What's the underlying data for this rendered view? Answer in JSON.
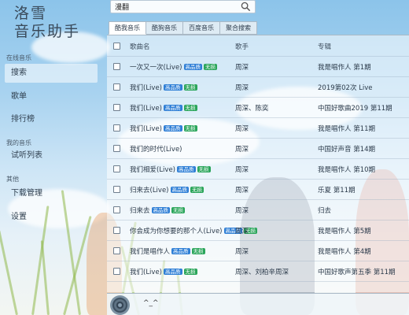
{
  "app": {
    "title_line1": "洛雪",
    "title_line2": "音乐助手"
  },
  "sidebar": {
    "sections": [
      {
        "label": "在线音乐",
        "items": [
          {
            "label": "搜索",
            "active": true
          },
          {
            "label": "歌单"
          },
          {
            "label": "排行榜"
          }
        ]
      },
      {
        "label": "我的音乐",
        "items": [
          {
            "label": "试听列表"
          }
        ]
      },
      {
        "label": "其他",
        "items": [
          {
            "label": "下载管理"
          },
          {
            "label": "设置"
          }
        ]
      }
    ]
  },
  "search": {
    "value": "漫翻",
    "icon": "search-icon"
  },
  "tabs": [
    {
      "label": "酷我音乐",
      "active": true
    },
    {
      "label": "酷狗音乐"
    },
    {
      "label": "百度音乐"
    },
    {
      "label": "聚合搜索"
    }
  ],
  "table": {
    "headers": {
      "name": "歌曲名",
      "artist": "歌手",
      "album": "专辑"
    },
    "rows": [
      {
        "name": "一次又一次(Live)",
        "badges": [
          "高品质",
          "无损"
        ],
        "artist": "周深",
        "album": "我是唱作人 第1期"
      },
      {
        "name": "我们(Live)",
        "badges": [
          "高品质",
          "无损"
        ],
        "artist": "周深",
        "album": "2019第02次 Live"
      },
      {
        "name": "我们(Live)",
        "badges": [
          "高品质",
          "无损"
        ],
        "artist": "周深、陈奕",
        "album": "中国好歌曲2019 第11期"
      },
      {
        "name": "我们(Live)",
        "badges": [
          "高品质",
          "无损"
        ],
        "artist": "周深",
        "album": "我是唱作人 第11期"
      },
      {
        "name": "我们的时代(Live)",
        "badges": [],
        "artist": "周深",
        "album": "中国好声音 第14期"
      },
      {
        "name": "我们相爱(Live)",
        "badges": [
          "高品质",
          "无损"
        ],
        "artist": "周深",
        "album": "我是唱作人 第10期"
      },
      {
        "name": "归来去(Live)",
        "badges": [
          "高品质",
          "无损"
        ],
        "artist": "周深",
        "album": "乐夏 第11期"
      },
      {
        "name": "归来去",
        "badges": [
          "高品质",
          "无损"
        ],
        "artist": "周深",
        "album": "归去"
      },
      {
        "name": "你会成为你想要的那个人(Live)",
        "badges": [
          "高品质",
          "无损"
        ],
        "artist": "周深",
        "album": "我是唱作人 第5期"
      },
      {
        "name": "我们是唱作人",
        "badges": [
          "高品质",
          "无损"
        ],
        "artist": "周深",
        "album": "我是唱作人 第4期"
      },
      {
        "name": "我们(Live)",
        "badges": [
          "高品质",
          "无损"
        ],
        "artist": "周深、刘柏辛周深",
        "album": "中国好歌声第五季 第11期"
      }
    ]
  },
  "player": {
    "text": "^_^"
  },
  "colors": {
    "badge_hq": "#2f7fd6",
    "badge_lossless": "#2aa55a",
    "accent": "#aab9c6"
  }
}
